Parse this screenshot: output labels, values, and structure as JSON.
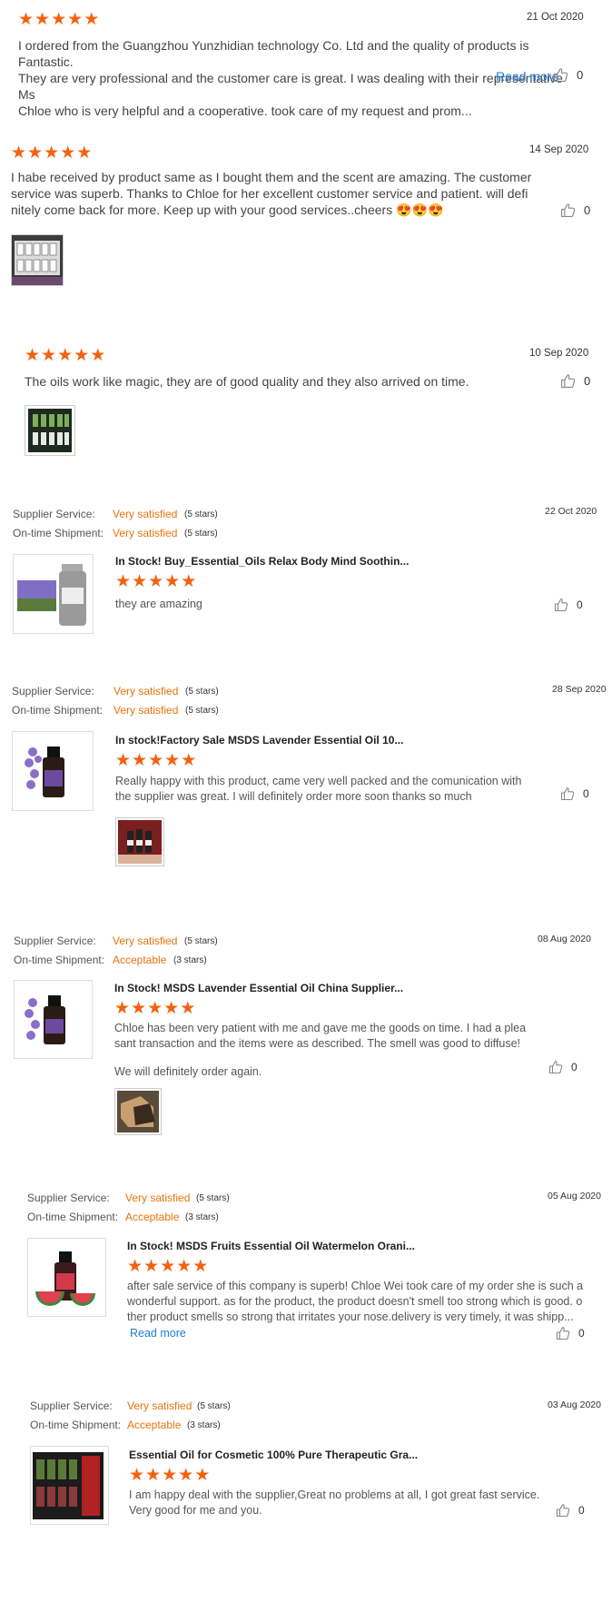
{
  "reviews": [
    {
      "date": "21 Oct 2020",
      "text_lines": [
        "I ordered from the Guangzhou Yunzhidian technology Co. Ltd and the quality of products is Fantastic.",
        "They are very professional and the customer care is great. I was dealing with their representative Ms",
        "Chloe who is very helpful and a cooperative. took care of my request and prom..."
      ],
      "read_more": "Read more",
      "likes": "0",
      "stars": 5
    },
    {
      "date": "14 Sep 2020",
      "text_lines": [
        "I habe received by product same as I bought them and the scent are amazing. The customer",
        "service was superb. Thanks to Chloe for her excellent customer service and patient. will defi",
        "nitely come back for more. Keep up with your good services..cheers"
      ],
      "emoji": "😍😍😍",
      "likes": "0",
      "stars": 5
    },
    {
      "date": "10 Sep 2020",
      "text_lines": [
        "The oils work like magic, they are of good quality and they also arrived on time."
      ],
      "likes": "0",
      "stars": 5
    }
  ],
  "labels": {
    "supplier_service": "Supplier Service:",
    "ontime_shipment": "On-time Shipment:"
  },
  "product_reviews": [
    {
      "date": "22 Oct 2020",
      "supplier": {
        "value": "Very satisfied",
        "count": "(5 stars)"
      },
      "shipment": {
        "value": "Very satisfied",
        "count": "(5 stars)"
      },
      "product_title": "In Stock! Buy_Essential_Oils Relax Body Mind Soothin...",
      "stars": 5,
      "text_lines": [
        "they are amazing"
      ],
      "likes": "0"
    },
    {
      "date": "28 Sep 2020",
      "supplier": {
        "value": "Very satisfied",
        "count": "(5 stars)"
      },
      "shipment": {
        "value": "Very satisfied",
        "count": "(5 stars)"
      },
      "product_title": "In stock!Factory Sale MSDS Lavender Essential Oil 10...",
      "stars": 5,
      "text_lines": [
        "Really happy with this product, came very well packed and the comunication with",
        "the supplier was great. I will definitely order more soon thanks so much"
      ],
      "likes": "0"
    },
    {
      "date": "08 Aug 2020",
      "supplier": {
        "value": "Very satisfied",
        "count": "(5 stars)"
      },
      "shipment": {
        "value": "Acceptable",
        "count": "(3 stars)"
      },
      "product_title": "In Stock! MSDS Lavender Essential Oil China Supplier...",
      "stars": 5,
      "text_lines": [
        "Chloe has been very patient with me and gave me the goods on time. I had a plea",
        "sant transaction and the items were as described. The smell was good to diffuse!",
        "",
        "We will definitely order again."
      ],
      "likes": "0"
    },
    {
      "date": "05 Aug 2020",
      "supplier": {
        "value": "Very satisfied",
        "count": "(5 stars)"
      },
      "shipment": {
        "value": "Acceptable",
        "count": "(3 stars)"
      },
      "product_title": "In Stock! MSDS Fruits Essential Oil Watermelon Orani...",
      "stars": 5,
      "text_lines": [
        "after sale service of this company is superb! Chloe Wei took care of my order she is such a",
        "wonderful support. as for the product, the product doesn't smell too strong which is good. o",
        "ther product smells so strong that irritates your nose.delivery is very timely, it was shipp..."
      ],
      "read_more": "Read more",
      "likes": "0"
    },
    {
      "date": "03 Aug 2020",
      "supplier": {
        "value": "Very satisfied",
        "count": "(5 stars)"
      },
      "shipment": {
        "value": "Acceptable",
        "count": "(3 stars)"
      },
      "product_title": "Essential Oil for Cosmetic 100% Pure Therapeutic Gra...",
      "stars": 5,
      "text_lines": [
        "I am happy deal with the supplier,Great no problems at all, I got great fast service.",
        "Very good for me and you."
      ],
      "likes": "0"
    }
  ],
  "colors": {
    "star": "#f2620f",
    "accent": "#e8730c",
    "link": "#1f7bd1"
  }
}
